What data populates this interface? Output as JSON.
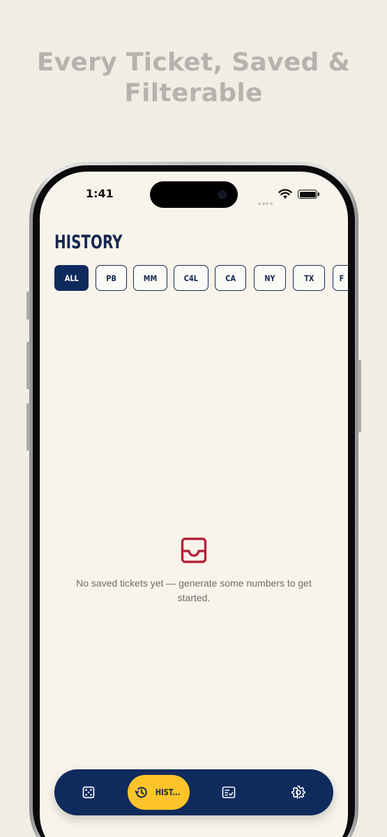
{
  "headline": {
    "line1": "Every Ticket, Saved &",
    "line2": "Filterable"
  },
  "status_bar": {
    "time": "1:41",
    "icons": [
      "cellular-icon",
      "wifi-icon",
      "battery-icon"
    ]
  },
  "screen": {
    "title": "HISTORY",
    "filters": [
      {
        "label": "ALL",
        "selected": true
      },
      {
        "label": "PB",
        "selected": false
      },
      {
        "label": "MM",
        "selected": false
      },
      {
        "label": "C4L",
        "selected": false
      },
      {
        "label": "CA",
        "selected": false
      },
      {
        "label": "NY",
        "selected": false
      },
      {
        "label": "TX",
        "selected": false
      },
      {
        "label": "F",
        "selected": false
      }
    ],
    "empty_state": {
      "icon": "inbox-icon",
      "message": "No saved tickets yet — generate some numbers to get started."
    }
  },
  "tab_bar": {
    "tabs": [
      {
        "icon": "dice-icon",
        "label": ""
      },
      {
        "icon": "history-icon",
        "label": "HIST...",
        "selected": true
      },
      {
        "icon": "ticket-check-icon",
        "label": ""
      },
      {
        "icon": "gear-icon",
        "label": ""
      }
    ]
  },
  "colors": {
    "page_background": "#f0ede4",
    "screen_background": "#f8f4eb",
    "navy": "#0f2a5c",
    "accent_yellow": "#fcc42a",
    "empty_icon_red": "#b3243a",
    "headline_gray": "#b5b3ae"
  }
}
